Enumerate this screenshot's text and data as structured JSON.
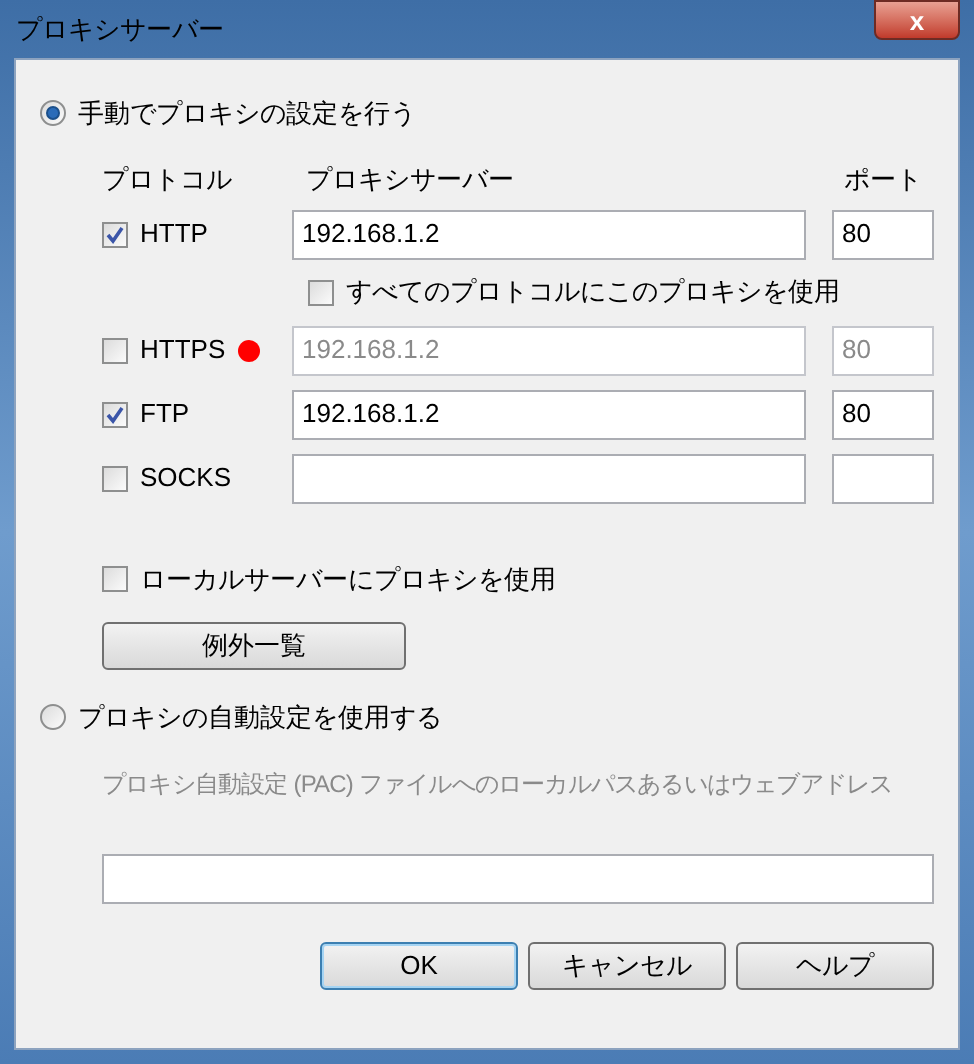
{
  "window": {
    "title": "プロキシサーバー",
    "close_label": "x"
  },
  "manual": {
    "label": "手動でプロキシの設定を行う",
    "selected": true
  },
  "headers": {
    "protocol": "プロトコル",
    "server": "プロキシサーバー",
    "port": "ポート"
  },
  "protocols": [
    {
      "name": "HTTP",
      "checked": true,
      "disabled": false,
      "server": "192.168.1.2",
      "port": "80"
    },
    {
      "kind": "all",
      "label": "すべてのプロトコルにこのプロキシを使用",
      "checked": false
    },
    {
      "name": "HTTPS",
      "checked": false,
      "disabled": true,
      "server": "192.168.1.2",
      "port": "80",
      "color": "#ff0000"
    },
    {
      "name": "FTP",
      "checked": true,
      "disabled": false,
      "server": "192.168.1.2",
      "port": "80"
    },
    {
      "name": "SOCKS",
      "checked": false,
      "disabled": false
    }
  ],
  "local": {
    "label": "ローカルサーバーにプロキシを使用",
    "checked": false
  },
  "exceptions_button": "例外一覧",
  "auto": {
    "label": "プロキシの自動設定を使用する",
    "selected": false,
    "description": "プロキシ自動設定 (PAC) ファイルへのローカルパスあるいはウェブアドレス",
    "disabled": true
  },
  "buttons": [
    {
      "label": "OK",
      "default": true
    },
    {
      "label": "キャンセル",
      "default": false
    },
    {
      "label": "ヘルプ",
      "default": false
    }
  ]
}
